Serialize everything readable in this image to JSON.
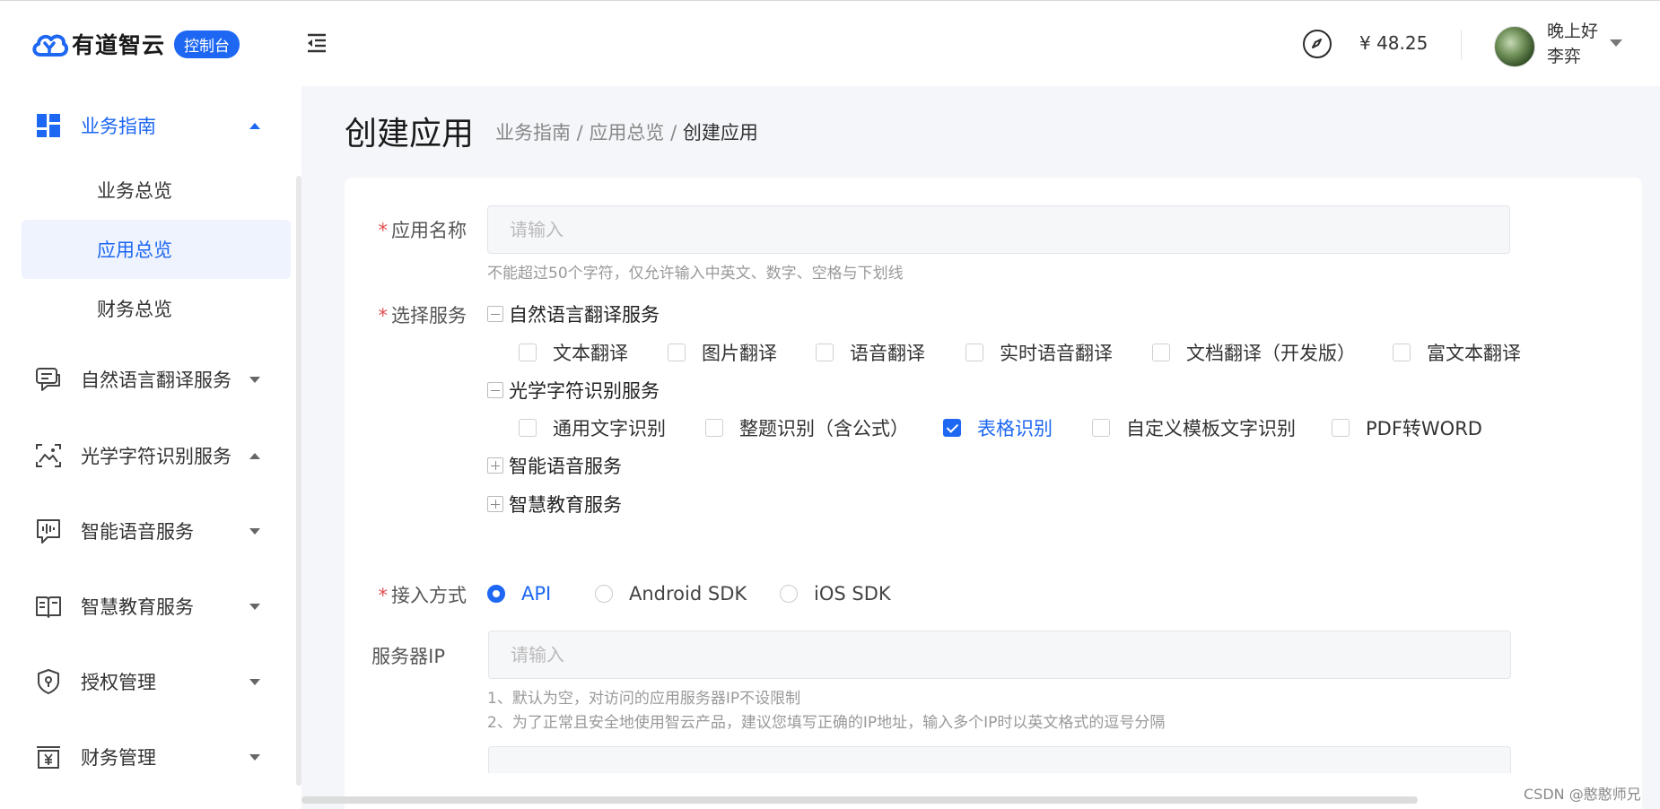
{
  "header": {
    "logo_text": "有道智云",
    "logo_badge": "控制台",
    "balance": "¥ 48.25",
    "greeting": "晚上好",
    "username": "李弈"
  },
  "sidebar": {
    "items": [
      {
        "label": "业务指南",
        "icon": "dashboard-icon",
        "expanded": true
      },
      {
        "label": "自然语言翻译服务",
        "icon": "chat-translate-icon"
      },
      {
        "label": "光学字符识别服务",
        "icon": "image-scan-icon"
      },
      {
        "label": "智能语音服务",
        "icon": "voice-wave-icon"
      },
      {
        "label": "智慧教育服务",
        "icon": "open-book-icon"
      },
      {
        "label": "授权管理",
        "icon": "shield-key-icon"
      },
      {
        "label": "财务管理",
        "icon": "finance-yen-icon"
      }
    ],
    "sub_items": [
      {
        "label": "业务总览"
      },
      {
        "label": "应用总览",
        "selected": true
      },
      {
        "label": "财务总览"
      }
    ]
  },
  "page": {
    "title": "创建应用",
    "breadcrumb": {
      "a": "业务指南",
      "sep1": " / ",
      "b": "应用总览",
      "sep2": " / ",
      "c": "创建应用"
    }
  },
  "form": {
    "app_name": {
      "label": "应用名称",
      "required": "*",
      "placeholder": "请输入",
      "hint": "不能超过50个字符，仅允许输入中英文、数字、空格与下划线"
    },
    "services": {
      "label": "选择服务",
      "required": "*",
      "groups": [
        {
          "label": "自然语言翻译服务",
          "state": "expanded",
          "items": [
            {
              "label": "文本翻译",
              "checked": false
            },
            {
              "label": "图片翻译",
              "checked": false
            },
            {
              "label": "语音翻译",
              "checked": false
            },
            {
              "label": "实时语音翻译",
              "checked": false
            },
            {
              "label": "文档翻译（开发版）",
              "checked": false
            },
            {
              "label": "富文本翻译",
              "checked": false
            }
          ]
        },
        {
          "label": "光学字符识别服务",
          "state": "expanded",
          "items": [
            {
              "label": "通用文字识别",
              "checked": false
            },
            {
              "label": "整题识别（含公式）",
              "checked": false
            },
            {
              "label": "表格识别",
              "checked": true
            },
            {
              "label": "自定义模板文字识别",
              "checked": false
            },
            {
              "label": "PDF转WORD",
              "checked": false
            }
          ]
        },
        {
          "label": "智能语音服务",
          "state": "collapsed"
        },
        {
          "label": "智慧教育服务",
          "state": "collapsed"
        }
      ]
    },
    "access": {
      "label": "接入方式",
      "required": "*",
      "options": [
        {
          "label": "API",
          "selected": true
        },
        {
          "label": "Android SDK",
          "selected": false
        },
        {
          "label": "iOS SDK",
          "selected": false
        }
      ]
    },
    "server_ip": {
      "label": "服务器IP",
      "placeholder": "请输入",
      "hint1": "1、默认为空，对访问的应用服务器IP不设限制",
      "hint2": "2、为了正常且安全地使用智云产品，建议您填写正确的IP地址，输入多个IP时以英文格式的逗号分隔"
    }
  },
  "watermark": "CSDN @憨憨师兄",
  "colors": {
    "accent": "#1d67f2",
    "required": "#e34d4d",
    "main_bg": "#f4f6fa"
  }
}
